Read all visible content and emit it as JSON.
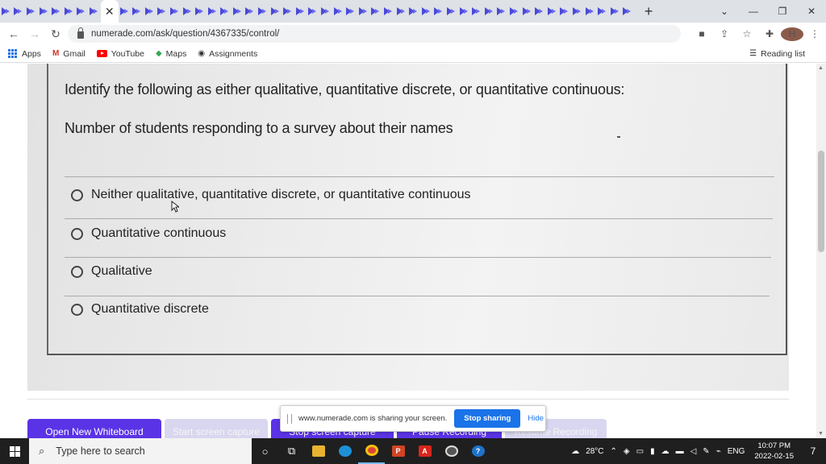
{
  "browser": {
    "active_tab_close": "✕",
    "new_tab": "+",
    "window_controls": {
      "menu": "⌄",
      "minimize": "—",
      "maximize": "❐",
      "close": "✕"
    },
    "nav": {
      "back": "←",
      "forward": "→",
      "reload": "↻"
    },
    "url": "numerade.com/ask/question/4367335/control/",
    "profile_initial": "H"
  },
  "bookmarks": {
    "items": [
      "Apps",
      "Gmail",
      "YouTube",
      "Maps",
      "Assignments"
    ],
    "reading_list": "Reading list"
  },
  "question": {
    "instruction": "Identify the following as either qualitative, quantitative discrete, or quantitative continuous:",
    "prompt": "Number of students responding to a survey about their names",
    "options": [
      "Neither qualitative, quantitative discrete, or quantitative continuous",
      "Quantitative continuous",
      "Qualitative",
      "Quantitative discrete"
    ]
  },
  "whiteboard": {
    "open": "Open New Whiteboard",
    "start_capture": "Start screen capture",
    "stop_capture": "Stop screen capture",
    "pause": "Pause Recording",
    "resume": "Resume Recording"
  },
  "share_bar": {
    "message": "www.numerade.com is sharing your screen.",
    "stop": "Stop sharing",
    "hide": "Hide"
  },
  "taskbar": {
    "search_placeholder": "Type here to search",
    "weather": "28°C",
    "language": "ENG",
    "time": "10:07 PM",
    "date": "2022-02-15",
    "notifications": "7"
  }
}
